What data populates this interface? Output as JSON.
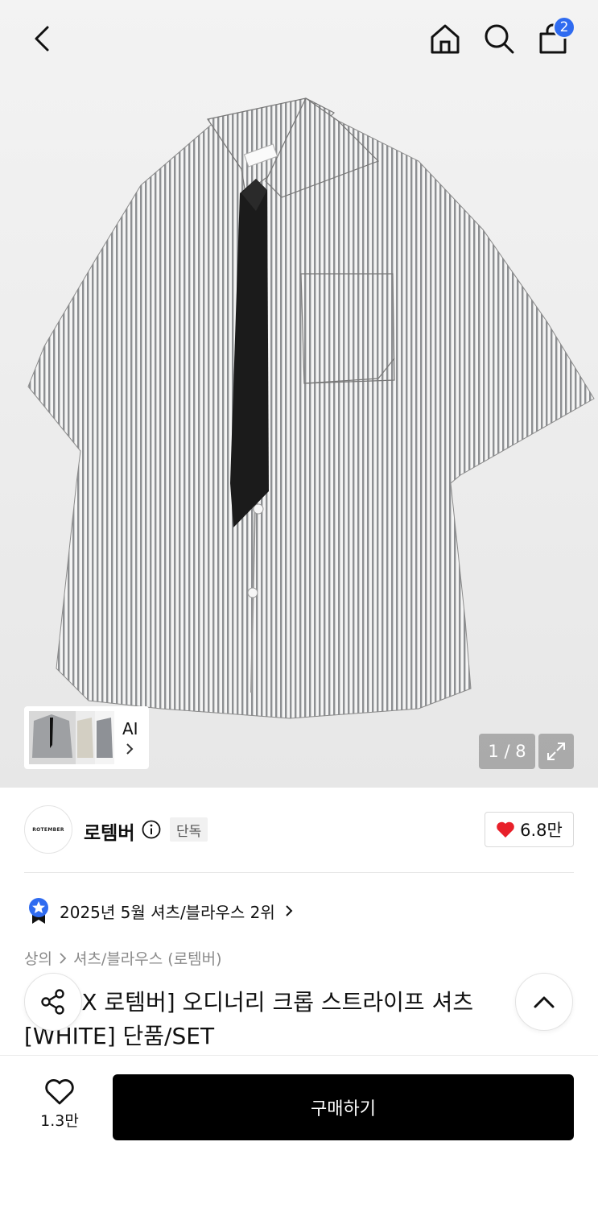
{
  "header": {
    "back_icon": "chevron-left-icon",
    "home_icon": "home-icon",
    "search_icon": "search-icon",
    "cart_icon": "shopping-bag-icon",
    "cart_count": "2"
  },
  "gallery": {
    "ai_label": "AI",
    "current": "1",
    "separator": "/",
    "total": "8",
    "pager_text": "1 / 8"
  },
  "brand": {
    "logo_text": "ROTEMBER",
    "name": "로템버",
    "exclusive_badge": "단독",
    "likes": "6.8만"
  },
  "ranking": {
    "text": "2025년 5월 셔츠/블라우스 2위"
  },
  "breadcrumb": {
    "category": "상의",
    "subcategory": "셔츠/블라우스 (로템버)"
  },
  "product": {
    "title": "[리룸 X 로템버] 오디너리 크롭 스트라이프 셔츠 [WHITE] 단품/SET"
  },
  "bottom_bar": {
    "wish_count": "1.3만",
    "buy_label": "구매하기"
  },
  "colors": {
    "badge_blue": "#2f6bf0",
    "heart_red": "#e8202a",
    "buy_black": "#000000"
  }
}
